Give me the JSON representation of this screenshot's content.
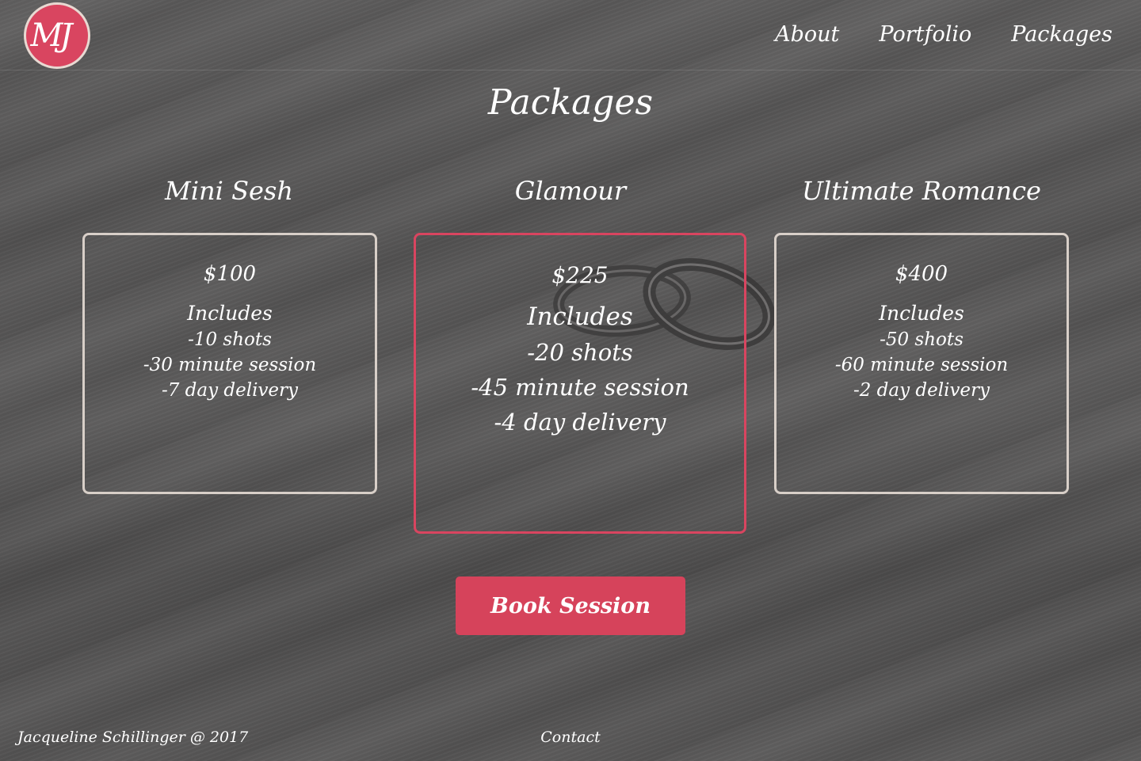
{
  "brand": {
    "logo_text": "MJ",
    "accent_color": "#d94560",
    "border_color": "#d8cfc8"
  },
  "nav": {
    "items": [
      {
        "label": "About"
      },
      {
        "label": "Portfolio"
      },
      {
        "label": "Packages"
      }
    ]
  },
  "page": {
    "title": "Packages"
  },
  "packages": [
    {
      "name": "Mini Sesh",
      "price": "$100",
      "includes_label": "Includes",
      "features": [
        "-10 shots",
        "-30 minute session",
        "-7 day delivery"
      ],
      "featured": false
    },
    {
      "name": "Glamour",
      "price": "$225",
      "includes_label": "Includes",
      "features": [
        "-20 shots",
        "-45 minute session",
        "-4 day delivery"
      ],
      "featured": true
    },
    {
      "name": "Ultimate Romance",
      "price": "$400",
      "includes_label": "Includes",
      "features": [
        "-50 shots",
        "-60 minute session",
        "-2 day delivery"
      ],
      "featured": false
    }
  ],
  "cta": {
    "label": "Book Session"
  },
  "footer": {
    "copyright": "Jacqueline Schillinger @ 2017",
    "contact_label": "Contact"
  },
  "icons": {
    "logo": "monogram-logo-icon"
  }
}
